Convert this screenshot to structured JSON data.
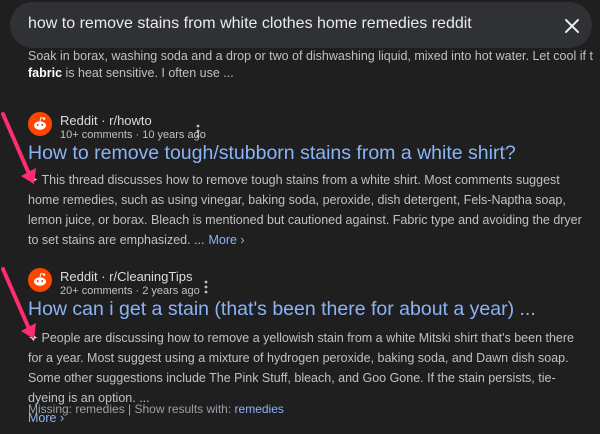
{
  "search": {
    "query": "how to remove stains from white clothes home remedies reddit",
    "clear_icon": "close-icon"
  },
  "top_snippet": {
    "line1": "Soak in borax, washing soda and a drop or two of dishwashing liquid, mixed into hot water. Let cool if the",
    "line2_bold": "fabric",
    "line2_rest": " is heat sensitive. I often use ..."
  },
  "results": [
    {
      "site": "Reddit · r/howto",
      "meta": "10+ comments · 10 years ago",
      "title": "How to remove tough/stubborn stains from a white shirt?",
      "snippet": "This thread discusses how to remove tough stains from a white shirt. Most comments suggest home remedies, such as using vinegar, baking soda, peroxide, dish detergent, Fels-Naptha soap, lemon juice, or borax. Bleach is mentioned but cautioned against. Fabric type and avoiding the dryer to set stains are emphasized. ...",
      "more_label": "More ›"
    },
    {
      "site": "Reddit · r/CleaningTips",
      "meta": "20+ comments · 2 years ago",
      "title": "How can i get a stain (that's been there for about a year) ...",
      "snippet": "People are discussing how to remove a yellowish stain from a white Mitski shirt that's been there for a year. Most suggest using a mixture of hydrogen peroxide, baking soda, and Dawn dish soap. Some other suggestions include The Pink Stuff, bleach, and Goo Gone. If the stain persists, tie-dyeing is an option. ...",
      "more_label": "More ›"
    }
  ],
  "missing": {
    "prefix": "Missing: remedies | Show results with: ",
    "link": "remedies"
  },
  "sparkle_glyph": "✦",
  "colors": {
    "background": "#1f1f1f",
    "search_bar": "#303134",
    "link_blue": "#8ab4f8",
    "reddit_orange": "#ff4500",
    "annotation_arrow": "#ff2d6f"
  }
}
